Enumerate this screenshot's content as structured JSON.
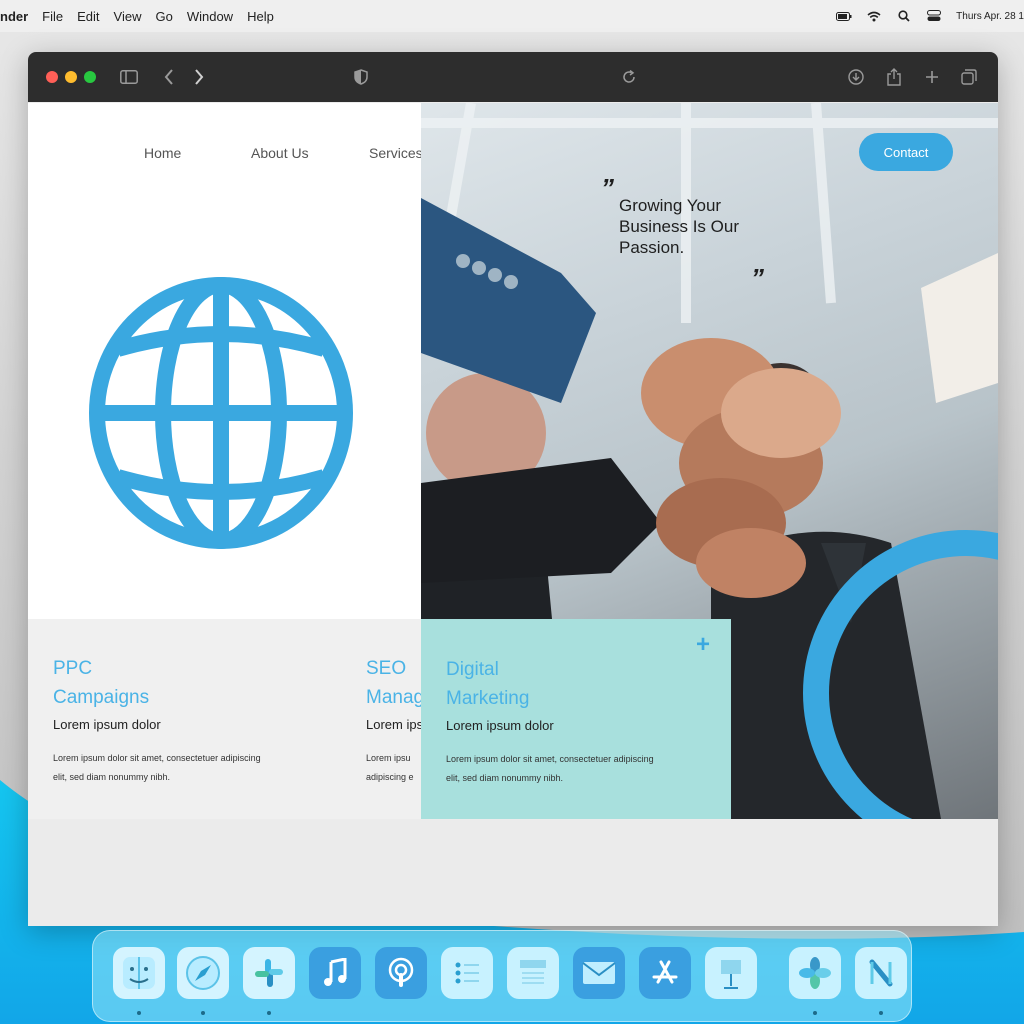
{
  "menubar": {
    "app_name": "nder",
    "items": [
      "File",
      "Edit",
      "View",
      "Go",
      "Window",
      "Help"
    ],
    "clock": "Thurs Apr. 28 1"
  },
  "browser": {
    "toolbar_icons": [
      "sidebar-icon",
      "back-icon",
      "forward-icon",
      "shield-icon",
      "reload-icon",
      "download-icon",
      "share-icon",
      "new-tab-icon",
      "tabs-icon"
    ]
  },
  "website": {
    "nav": {
      "home": "Home",
      "about": "About Us",
      "services": "Services"
    },
    "contact_button": "Contact",
    "hero_quote": "Growing Your Business Is Our Passion.",
    "quote_open": "”",
    "quote_close": "”",
    "cards": [
      {
        "title_line1": "PPC",
        "title_line2": "Campaigns",
        "subtitle": "Lorem ipsum dolor",
        "body": "Lorem ipsum dolor sit amet, consectetuer adipiscing elit, sed diam nonummy nibh."
      },
      {
        "title_line1": "SEO",
        "title_line2": "Manag",
        "subtitle": "Lorem ips",
        "body": "Lorem ipsu adipiscing e"
      },
      {
        "title_line1": "Digital",
        "title_line2": "Marketing",
        "subtitle": "Lorem ipsum dolor",
        "body": "Lorem ipsum dolor sit amet, consectetuer adipiscing elit, sed diam nonummy nibh.",
        "plus_icon": "+"
      }
    ],
    "colors": {
      "accent": "#3aa8e0",
      "card_highlight": "#a8e0dd",
      "card_gray": "#f0f0f0"
    }
  },
  "dock": {
    "apps": [
      "finder-icon",
      "safari-icon",
      "slack-icon",
      "music-icon",
      "podcasts-icon",
      "reminders-icon",
      "notes-icon",
      "mail-icon",
      "app-store-icon",
      "keynote-icon",
      "photos-icon",
      "news-icon"
    ]
  }
}
